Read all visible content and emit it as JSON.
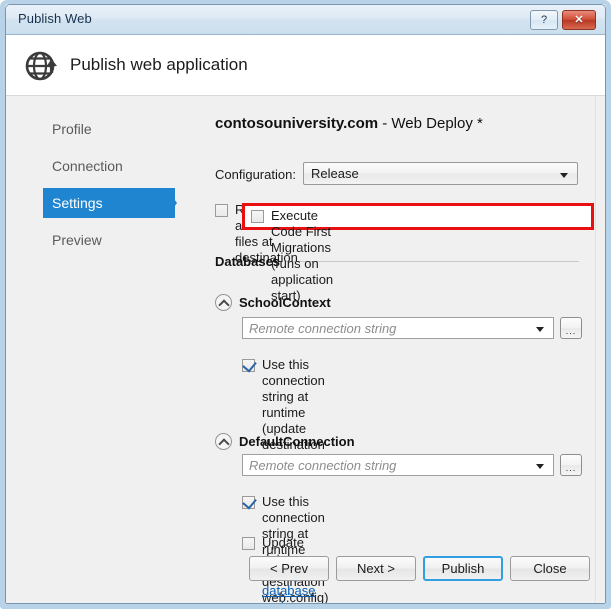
{
  "window": {
    "title": "Publish Web",
    "help_button": "?",
    "close_button": "✕"
  },
  "header": {
    "title": "Publish web application",
    "icon": "globe-publish-icon"
  },
  "sidebar": {
    "items": [
      {
        "label": "Profile",
        "selected": false
      },
      {
        "label": "Connection",
        "selected": false
      },
      {
        "label": "Settings",
        "selected": true
      },
      {
        "label": "Preview",
        "selected": false
      }
    ]
  },
  "main": {
    "panel_title_bold": "contosouniversity.com",
    "panel_title_rest": " - Web Deploy *",
    "configuration": {
      "label": "Configuration:",
      "value": "Release"
    },
    "remove_files": {
      "label": "Remove additional files at destination",
      "checked": false
    },
    "databases_group_label": "Databases",
    "databases": [
      {
        "name": "SchoolContext",
        "expanded": true,
        "connection_placeholder": "Remote connection string",
        "connection_value": "",
        "browse_button": "...",
        "options": [
          {
            "label": "Use this connection string at runtime (update destination\nweb.config)",
            "checked": true
          },
          {
            "label": "Execute Code First Migrations (runs on application start)",
            "checked": false,
            "highlighted": true
          }
        ]
      },
      {
        "name": "DefaultConnection",
        "expanded": true,
        "connection_placeholder": "Remote connection string",
        "connection_value": "",
        "browse_button": "...",
        "options": [
          {
            "label": "Use this connection string at runtime (update destination\nweb.config)",
            "checked": true
          },
          {
            "label": "Update database ",
            "checked": false,
            "link_label": "Configure database updates"
          }
        ]
      }
    ]
  },
  "footer": {
    "buttons": [
      {
        "label": "< Prev",
        "default": false
      },
      {
        "label": "Next >",
        "default": false
      },
      {
        "label": "Publish",
        "default": true
      },
      {
        "label": "Close",
        "default": false
      }
    ]
  },
  "colors": {
    "accent": "#1f85d0",
    "highlight": "#e81010",
    "link": "#0a5fb5"
  }
}
